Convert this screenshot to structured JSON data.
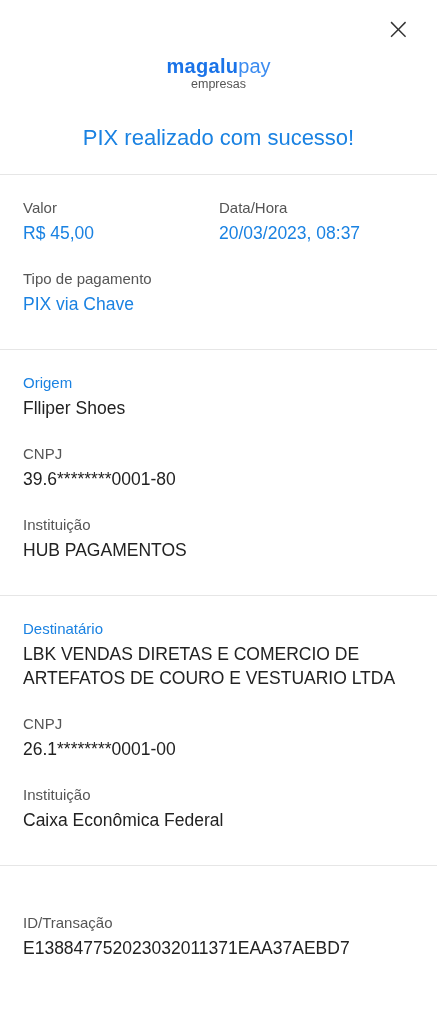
{
  "header": {
    "close": "×",
    "logo": {
      "brand": "magalu",
      "suffix": "pay",
      "sub": "empresas"
    },
    "title": "PIX realizado com sucesso!"
  },
  "sections": [
    {
      "kind": "summary",
      "fields": [
        {
          "label": "Valor",
          "value": "R$ 45,00"
        },
        {
          "label": "Data/Hora",
          "value": "20/03/2023, 08:37"
        },
        {
          "label": "Tipo de pagamento",
          "value": "PIX via Chave"
        }
      ]
    },
    {
      "kind": "party",
      "title": "Origem",
      "fields": [
        {
          "value": "Flliper Shoes"
        },
        {
          "label": "CNPJ",
          "value": "39.6********0001-80"
        },
        {
          "label": "Instituição",
          "value": "HUB PAGAMENTOS"
        }
      ]
    },
    {
      "kind": "party",
      "title": "Destinatário",
      "fields": [
        {
          "value": "LBK VENDAS DIRETAS E COMERCIO DE ARTEFATOS DE COURO E VESTUARIO LTDA"
        },
        {
          "label": "CNPJ",
          "value": "26.1********0001-00"
        },
        {
          "label": "Instituição",
          "value": "Caixa Econômica Federal"
        }
      ]
    },
    {
      "kind": "plain",
      "fields": [
        {
          "label": "ID/Transação",
          "value": "E138847752023032011371EAA37AEBD7"
        }
      ]
    }
  ]
}
